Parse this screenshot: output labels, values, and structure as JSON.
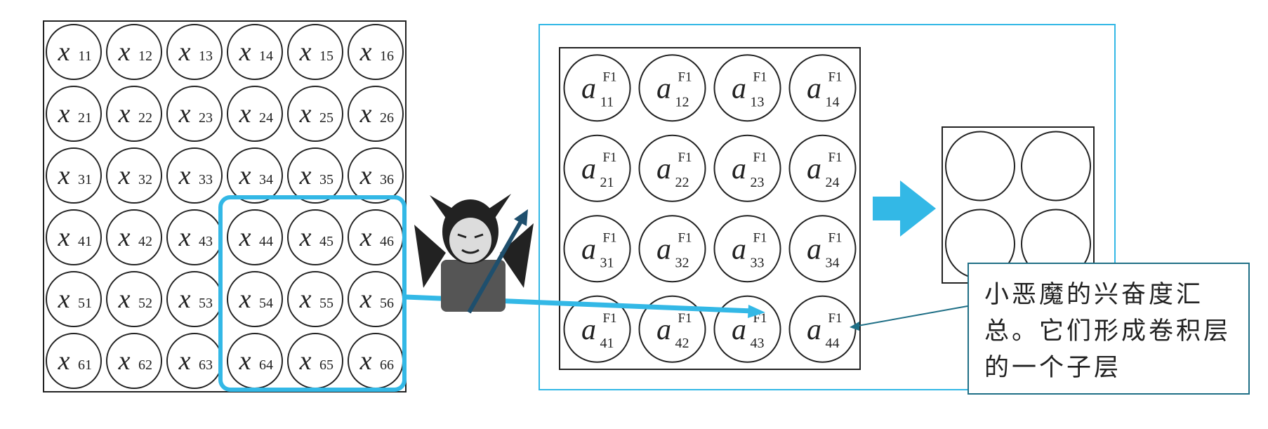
{
  "input_grid": {
    "symbol": "x",
    "rows": [
      [
        "11",
        "12",
        "13",
        "14",
        "15",
        "16"
      ],
      [
        "21",
        "22",
        "23",
        "24",
        "25",
        "26"
      ],
      [
        "31",
        "32",
        "33",
        "34",
        "35",
        "36"
      ],
      [
        "41",
        "42",
        "43",
        "44",
        "45",
        "46"
      ],
      [
        "51",
        "52",
        "53",
        "54",
        "55",
        "56"
      ],
      [
        "61",
        "62",
        "63",
        "64",
        "65",
        "66"
      ]
    ]
  },
  "feature_map": {
    "symbol": "a",
    "superscript": "F1",
    "rows": [
      [
        "11",
        "12",
        "13",
        "14"
      ],
      [
        "21",
        "22",
        "23",
        "24"
      ],
      [
        "31",
        "32",
        "33",
        "34"
      ],
      [
        "41",
        "42",
        "43",
        "44"
      ]
    ]
  },
  "pooled": {
    "rows": 2,
    "cols": 2
  },
  "note": {
    "text": "小恶魔的兴奋度汇总。它们形成卷积层的一个子层"
  },
  "colors": {
    "accent": "#33b8e6",
    "note_border": "#1f6f86",
    "line": "#222222"
  },
  "icons": {
    "demon": "demon-icon",
    "arrow": "right-arrow-icon"
  }
}
